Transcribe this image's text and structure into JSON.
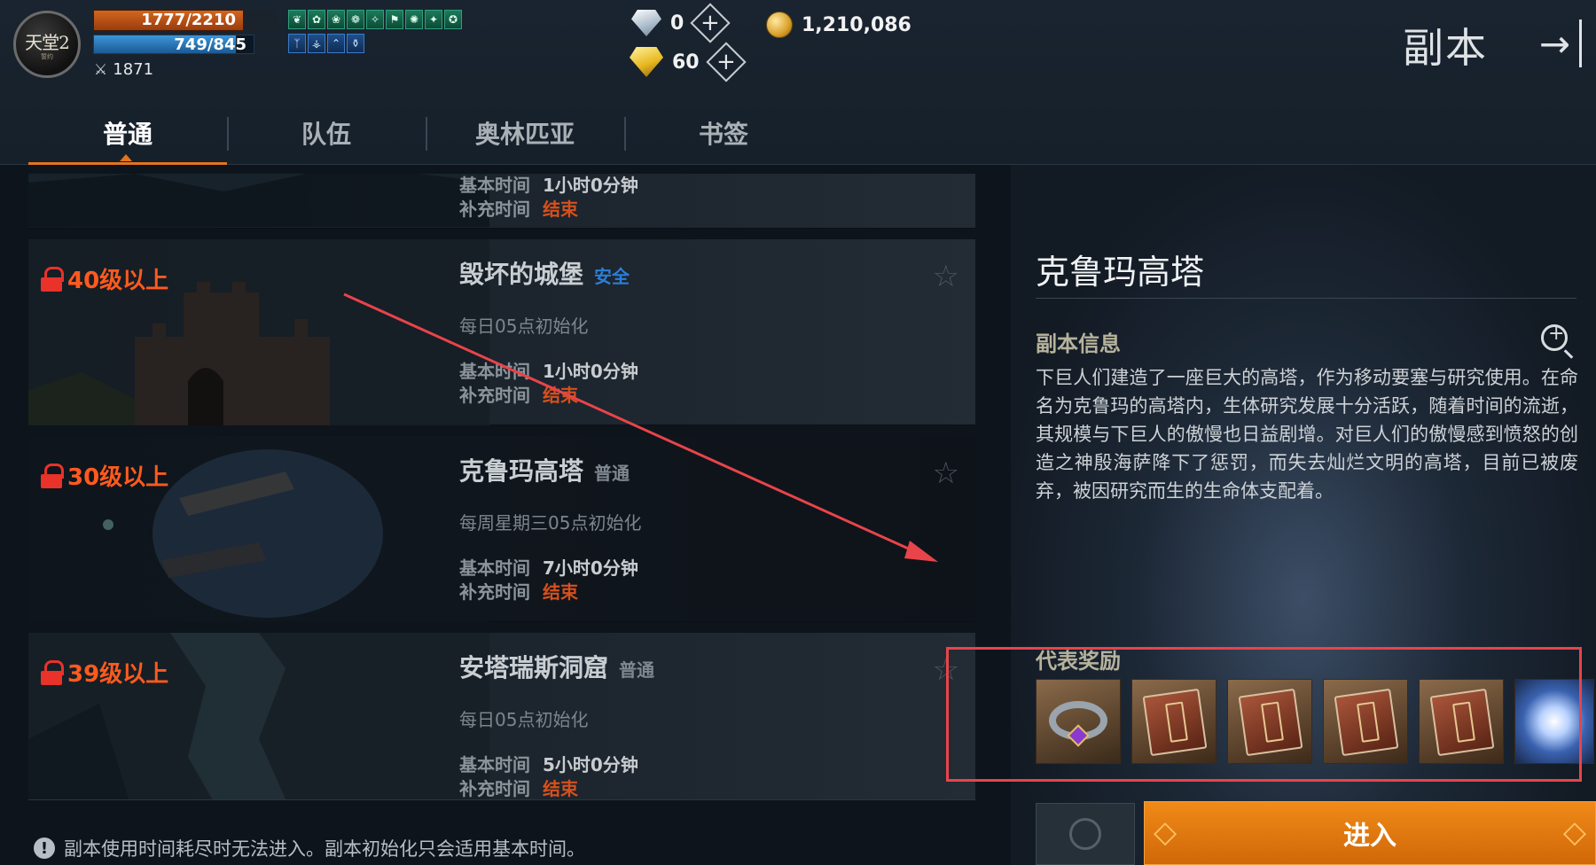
{
  "player": {
    "logo_text": "天堂2",
    "logo_sub": "誓约",
    "hp": "1777/2210",
    "mp": "749/845",
    "mp_fraction": 0.89,
    "combat_power": "1871"
  },
  "buffs_row1": [
    "❦",
    "✿",
    "❀",
    "❁",
    "✧",
    "⚑",
    "✺",
    "✦",
    "✪"
  ],
  "buffs_row2": [
    "ᛉ",
    "⚶",
    "⌃",
    "⚱"
  ],
  "currency": {
    "diamond": "0",
    "gold_gem": "60",
    "adena": "1,210,086"
  },
  "header": {
    "title": "副本",
    "exit_icon": "→"
  },
  "tabs": [
    {
      "label": "普通",
      "active": true
    },
    {
      "label": "队伍",
      "active": false
    },
    {
      "label": "奥林匹亚",
      "active": false
    },
    {
      "label": "书签",
      "active": false
    }
  ],
  "dungeons": [
    {
      "level": "",
      "name": "",
      "tag": "",
      "reset": "",
      "base_label": "基本时间",
      "base_time": "1小时0分钟",
      "extra_label": "补充时间",
      "extra_time": "结束"
    },
    {
      "level": "40级以上",
      "name": "毁坏的城堡",
      "tag": "安全",
      "reset": "每日05点初始化",
      "base_label": "基本时间",
      "base_time": "1小时0分钟",
      "extra_label": "补充时间",
      "extra_time": "结束"
    },
    {
      "level": "30级以上",
      "name": "克鲁玛高塔",
      "tag": "普通",
      "reset": "每周星期三05点初始化",
      "base_label": "基本时间",
      "base_time": "7小时0分钟",
      "extra_label": "补充时间",
      "extra_time": "结束"
    },
    {
      "level": "39级以上",
      "name": "安塔瑞斯洞窟",
      "tag": "普通",
      "reset": "每日05点初始化",
      "base_label": "基本时间",
      "base_time": "5小时0分钟",
      "extra_label": "补充时间",
      "extra_time": "结束"
    }
  ],
  "detail": {
    "title": "克鲁玛高塔",
    "info_heading": "副本信息",
    "description": "下巨人们建造了一座巨大的高塔，作为移动要塞与研究使用。在命名为克鲁玛的高塔内，生体研究发展十分活跃，随着时间的流逝，其规模与下巨人的傲慢也日益剧增。对巨人们的傲慢感到愤怒的创造之神殷海萨降下了惩罚，而失去灿烂文明的高塔，目前已被废弃，被因研究而生的生命体支配着。",
    "rewards_heading": "代表奖励",
    "rewards": [
      "ring",
      "book",
      "book",
      "book",
      "book",
      "orb"
    ],
    "enter_label": "进入"
  },
  "notice": "副本使用时间耗尽时无法进入。副本初始化只会适用基本时间。",
  "colors": {
    "accent_orange": "#e3741e",
    "lock_red": "#e8322a",
    "safe_blue": "#2a7fd6",
    "annotation_red": "#e8444a"
  }
}
